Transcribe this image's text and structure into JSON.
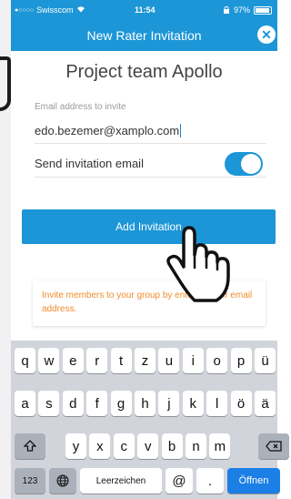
{
  "status_bar": {
    "carrier": "Swisscom",
    "time": "11:54",
    "battery": "97%"
  },
  "nav": {
    "title": "New Rater Invitation",
    "close_icon": "close-icon"
  },
  "project_title": "Project team Apollo",
  "email": {
    "label": "Email address to invite",
    "value": "edo.bezemer@xamplo.com"
  },
  "send_invitation": {
    "label": "Send invitation email",
    "enabled": true
  },
  "add_button": {
    "label": "Add Invitation"
  },
  "hint": {
    "text": "Invite members to your group by entering their email address."
  },
  "colors": {
    "accent": "#1c96d6",
    "hint_text": "#f08c2a"
  },
  "keyboard": {
    "row1": [
      "q",
      "w",
      "e",
      "r",
      "t",
      "z",
      "u",
      "i",
      "o",
      "p",
      "ü"
    ],
    "row2": [
      "a",
      "s",
      "d",
      "f",
      "g",
      "h",
      "j",
      "k",
      "l",
      "ö",
      "ä"
    ],
    "row3": [
      "y",
      "x",
      "c",
      "v",
      "b",
      "n",
      "m"
    ],
    "numbers_key": "123",
    "globe_icon": "globe-icon",
    "space_label": "Leerzeichen",
    "at_key": "@",
    "dot_key": ".",
    "return_label": "Öffnen",
    "shift_icon": "shift-icon",
    "delete_icon": "backspace-icon"
  }
}
